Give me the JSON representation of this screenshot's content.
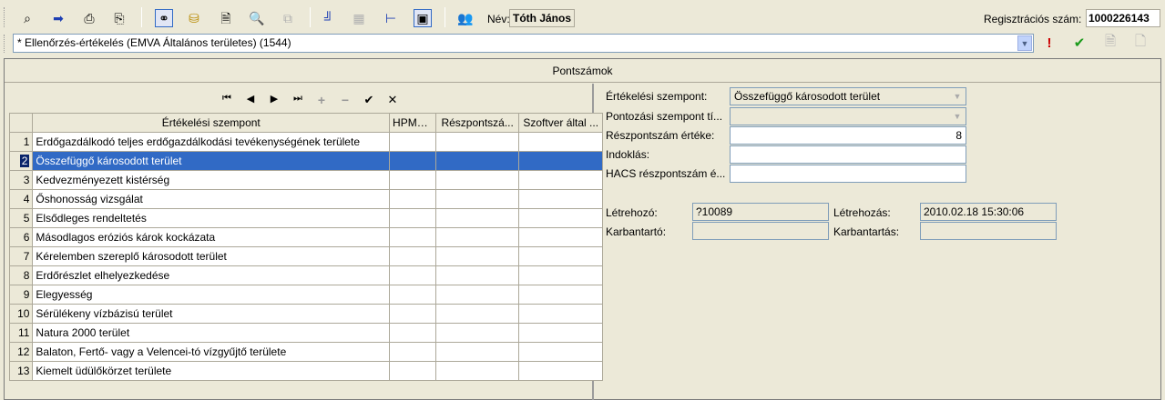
{
  "toolbar": {
    "nev_label": "Név:",
    "nev_value": "Tóth János",
    "reg_label": "Regisztrációs szám:",
    "reg_value": "1000226143"
  },
  "record_select": {
    "value": "* Ellenőrzés-értékelés (EMVA Általános területes) (1544)"
  },
  "frame": {
    "title": "Pontszámok"
  },
  "grid": {
    "columns": [
      "Értékelési szempont",
      "HPME...",
      "Részpontszá...",
      "Szoftver által ..."
    ],
    "rows": [
      {
        "num": "1",
        "label": "Erdőgazdálkodó teljes erdőgazdálkodási tevékenységének területe"
      },
      {
        "num": "2",
        "label": "Összefüggő károsodott terület"
      },
      {
        "num": "3",
        "label": "Kedvezményezett kistérség"
      },
      {
        "num": "4",
        "label": "Őshonosság vizsgálat"
      },
      {
        "num": "5",
        "label": "Elsődleges rendeltetés"
      },
      {
        "num": "6",
        "label": "Másodlagos eróziós károk kockázata"
      },
      {
        "num": "7",
        "label": "Kérelemben szereplő károsodott terület"
      },
      {
        "num": "8",
        "label": "Erdőrészlet elhelyezkedése"
      },
      {
        "num": "9",
        "label": "Elegyesség"
      },
      {
        "num": "10",
        "label": "Sérülékeny vízbázisú terület"
      },
      {
        "num": "11",
        "label": "Natura 2000 terület"
      },
      {
        "num": "12",
        "label": "Balaton, Fertő- vagy a Velencei-tó vízgyűjtő területe"
      },
      {
        "num": "13",
        "label": "Kiemelt üdülőkörzet területe"
      }
    ],
    "selected_row": 2
  },
  "form": {
    "ertekelesi_label": "Értékelési szempont:",
    "ertekelesi_value": "Összefüggő károsodott terület",
    "pontozasi_label": "Pontozási szempont tí...",
    "pontozasi_value": "",
    "reszpontszam_label": "Részpontszám értéke:",
    "reszpontszam_value": "8",
    "indoklas_label": "Indoklás:",
    "indoklas_value": "",
    "hacs_label": "HACS részpontszám é...",
    "hacs_value": "",
    "letrehozo_label": "Létrehozó:",
    "letrehozo_value": "?10089",
    "letrehozas_label": "Létrehozás:",
    "letrehozas_value": "2010.02.18 15:30:06",
    "karbantarto_label": "Karbantartó:",
    "karbantarto_value": "",
    "karbantartas_label": "Karbantartás:",
    "karbantartas_value": ""
  },
  "icons": {
    "binoculars": "binoculars-icon",
    "arrow_right": "arrow-right-icon",
    "print": "print-icon",
    "database": "database-icon",
    "users": "users-icon",
    "exclamation": "exclamation-icon",
    "check": "check-icon"
  },
  "colors": {
    "selection": "#316ac5",
    "exclamation": "#cc0000",
    "check": "#1a9a1a"
  }
}
